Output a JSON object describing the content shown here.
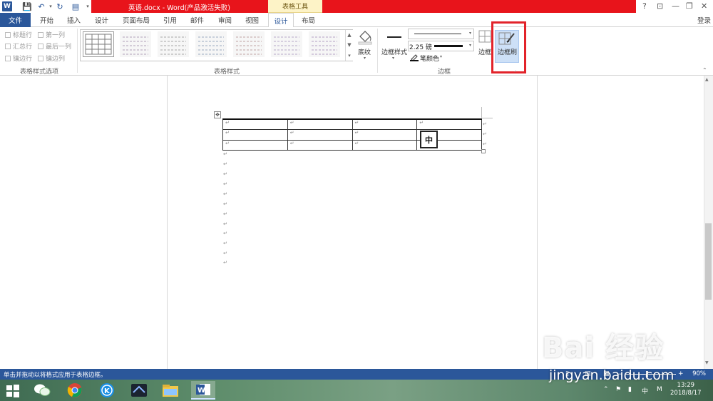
{
  "titlebar": {
    "doc_title": "英语.docx - Word(产品激活失败)",
    "context_group": "表格工具",
    "help": "?",
    "ribbon_opts": "⊡",
    "minimize": "—",
    "restore": "❐",
    "close": "✕"
  },
  "tabs": {
    "file": "文件",
    "home": "开始",
    "insert": "插入",
    "design": "设计",
    "page_layout": "页面布局",
    "references": "引用",
    "mailings": "邮件",
    "review": "审阅",
    "view": "视图",
    "table_design": "设计",
    "table_layout": "布局",
    "login": "登录"
  },
  "style_options": {
    "header_row": "标题行",
    "first_column": "第一列",
    "total_row": "汇总行",
    "last_column": "最后一列",
    "banded_rows": "镶边行",
    "banded_columns": "镶边列",
    "group_label": "表格样式选项"
  },
  "table_styles": {
    "shading": "底纹",
    "group_label": "表格样式"
  },
  "borders": {
    "border_styles": "边框样式",
    "weight": "2.25 磅",
    "pen_color": "笔颜色",
    "borders": "边框",
    "border_painter": "边框刷",
    "group_label": "边框"
  },
  "document": {
    "ime_char": "中",
    "para_mark": "↵"
  },
  "statusbar": {
    "text": "单击并拖动以将格式应用于表格边框。",
    "zoom": "90%"
  },
  "taskbar": {
    "ime": "中",
    "ime2": "M",
    "time": "13:29",
    "date": "2018/8/17"
  },
  "watermark": {
    "brand": "Bai 经验",
    "url": "jingyan.baidu.com"
  },
  "colors": {
    "word_blue": "#2b579a",
    "title_red": "#e8141b",
    "highlight_red": "#e2232a"
  }
}
